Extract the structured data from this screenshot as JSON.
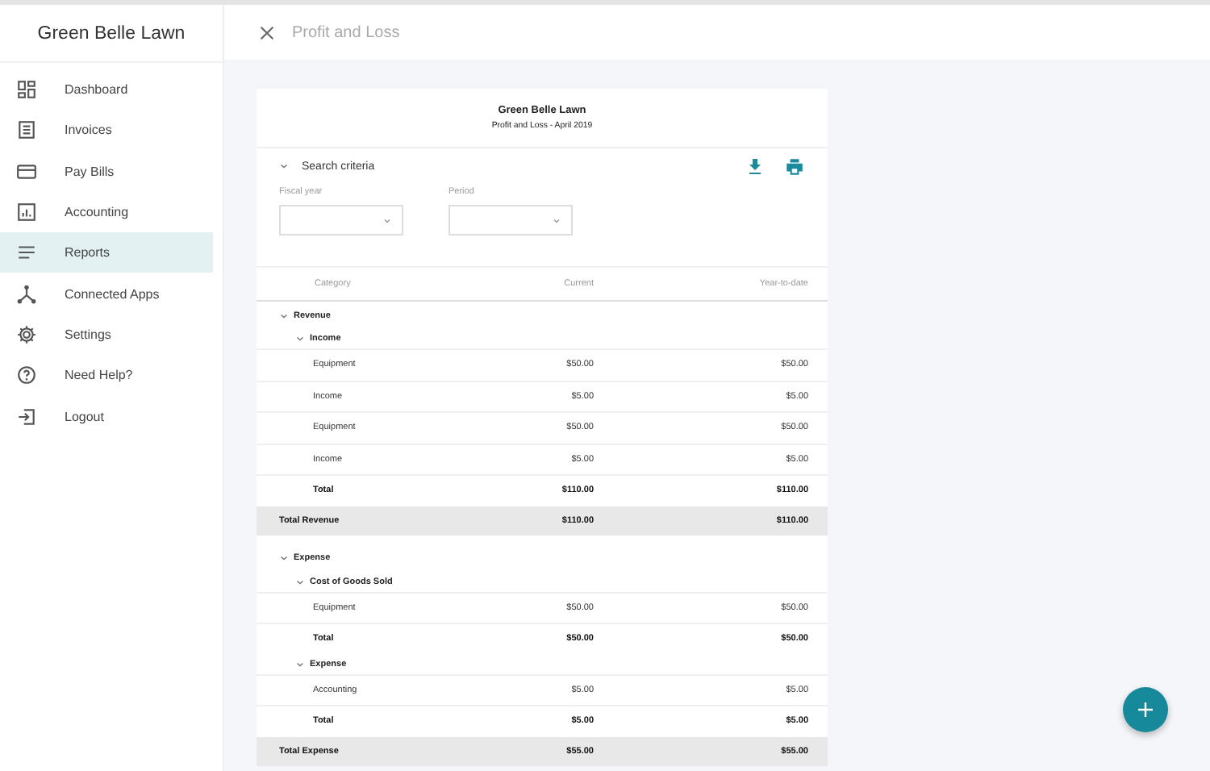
{
  "app": {
    "title": "Green Belle Lawn"
  },
  "sidebar": {
    "items": [
      {
        "label": "Dashboard",
        "selected": false
      },
      {
        "label": "Invoices",
        "selected": false
      },
      {
        "label": "Pay Bills",
        "selected": false
      },
      {
        "label": "Accounting",
        "selected": false
      },
      {
        "label": "Reports",
        "selected": true
      },
      {
        "label": "Connected Apps",
        "selected": false
      },
      {
        "label": "Settings",
        "selected": false
      },
      {
        "label": "Need Help?",
        "selected": false
      },
      {
        "label": "Logout",
        "selected": false
      }
    ]
  },
  "header": {
    "title": "Profit and Loss"
  },
  "report": {
    "company": "Green Belle Lawn",
    "subtitle": "Profit and Loss - April 2019",
    "search": {
      "label": "Search criteria",
      "expanded": true,
      "fields": [
        {
          "label": "Fiscal year"
        },
        {
          "label": "Period"
        }
      ]
    },
    "columns": [
      "Category",
      "Current",
      "Year-to-date"
    ],
    "sections": [
      {
        "label": "Revenue",
        "expanded": true,
        "groups": [
          {
            "label": "Income",
            "expanded": true,
            "rows": [
              {
                "kind": "line",
                "category": "Equipment",
                "current": "$50.00",
                "ytd": "$50.00"
              },
              {
                "kind": "line",
                "category": "Income",
                "current": "$5.00",
                "ytd": "$5.00"
              },
              {
                "kind": "line",
                "category": "Equipment",
                "current": "$50.00",
                "ytd": "$50.00"
              },
              {
                "kind": "line",
                "category": "Income",
                "current": "$5.00",
                "ytd": "$5.00"
              },
              {
                "kind": "total",
                "category": "Total",
                "current": "$110.00",
                "ytd": "$110.00"
              }
            ]
          }
        ],
        "total": {
          "category": "Total Revenue",
          "current": "$110.00",
          "ytd": "$110.00"
        }
      },
      {
        "label": "Expense",
        "expanded": true,
        "groups": [
          {
            "label": "Cost of Goods Sold",
            "expanded": true,
            "rows": [
              {
                "kind": "line",
                "category": "Equipment",
                "current": "$50.00",
                "ytd": "$50.00"
              },
              {
                "kind": "total",
                "category": "Total",
                "current": "$50.00",
                "ytd": "$50.00"
              }
            ]
          },
          {
            "label": "Expense",
            "expanded": true,
            "rows": [
              {
                "kind": "line",
                "category": "Accounting",
                "current": "$5.00",
                "ytd": "$5.00"
              },
              {
                "kind": "total",
                "category": "Total",
                "current": "$5.00",
                "ytd": "$5.00"
              }
            ]
          }
        ],
        "total": {
          "category": "Total Expense",
          "current": "$55.00",
          "ytd": "$55.00"
        }
      }
    ]
  }
}
